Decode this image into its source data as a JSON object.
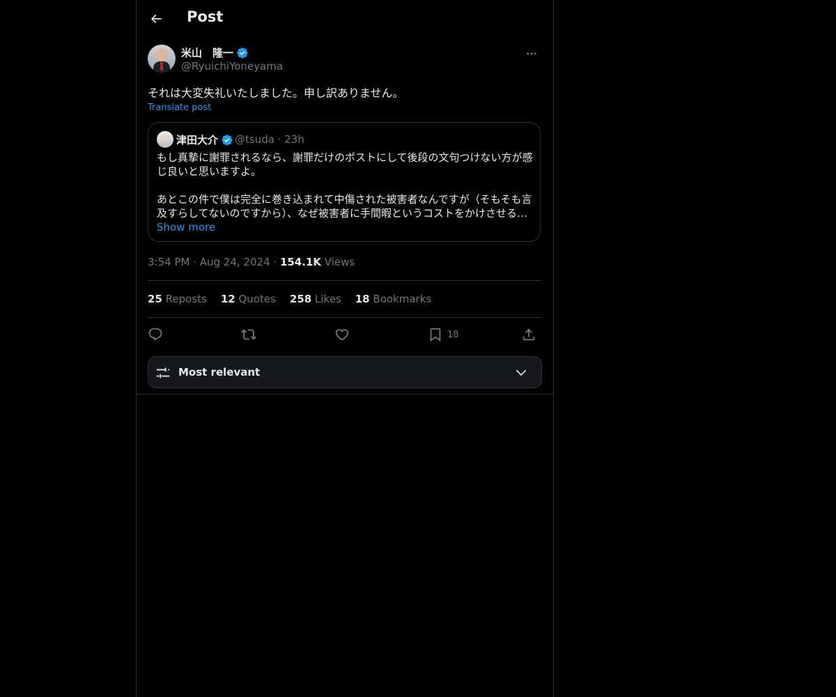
{
  "header": {
    "title": "Post"
  },
  "post": {
    "author_name": "米山　隆一",
    "author_handle": "@RyuichiYoneyama",
    "text": "それは大変失礼いたしました。申し訳ありません。",
    "translate_label": "Translate post",
    "quote": {
      "author_name": "津田大介",
      "author_handle": "@tsuda",
      "separator": " · ",
      "age": "23h",
      "text": "もし真摯に謝罪されるなら、謝罪だけのポストにして後段の文句つけない方が感じ良いと思いますよ。\n\nあとこの件で僕は完全に巻き込まれて中傷された被害者なんですが（そもそも言及すらしてないのですから）、なぜ被害者に手間暇というコストをかけさせる…",
      "show_more_label": "Show more"
    },
    "time": "3:54 PM",
    "dot": " · ",
    "date": "Aug 24, 2024",
    "views_count": "154.1K",
    "views_label": "Views"
  },
  "stats": {
    "reposts_count": "25",
    "reposts_label": "Reposts",
    "quotes_count": "12",
    "quotes_label": "Quotes",
    "likes_count": "258",
    "likes_label": "Likes",
    "bookmarks_count": "18",
    "bookmarks_label": "Bookmarks"
  },
  "actions": {
    "bookmark_count": "18"
  },
  "sorter": {
    "label": "Most relevant"
  },
  "colors": {
    "accent": "#1d9bf0",
    "background": "#000000",
    "muted": "#71767b",
    "border": "#2f3336"
  }
}
